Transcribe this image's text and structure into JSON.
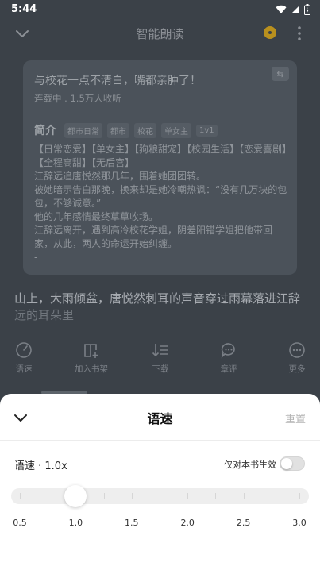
{
  "status_bar": {
    "time": "5:44"
  },
  "header": {
    "title": "智能朗读"
  },
  "book": {
    "title": "与校花一点不清白，嘴都亲肿了！",
    "status": "连载中 . 1.5万人收听",
    "intro_label": "简介",
    "tags": [
      "都市日常",
      "都市",
      "校花",
      "单女主",
      "1v1"
    ],
    "description": [
      "【日常恋爱】【单女主】【狗粮甜宠】【校园生活】【恋爱喜剧】【全程高甜】【无后宫】",
      "江辞远追唐悦然那几年，围着她团团转。",
      "被她暗示告白那晚，换来却是她冷嘲热讽：“没有几万块的包包，不够诚意。”",
      "他的几年感情最终草草收场。",
      "江辞远离开，遇到高冷校花学姐，阴差阳错学姐把他带回家，从此，两人的命运开始纠缠。",
      "-"
    ]
  },
  "reading": {
    "line1": "山上，大雨倾盆，唐悦然刺耳的声音穿过雨幕落进江辞",
    "line2": "远的耳朵里"
  },
  "toolbar": {
    "speed": "语速",
    "bookshelf": "加入书架",
    "chapters": "下载",
    "comments": "章评",
    "more": "更多"
  },
  "sheet": {
    "title": "语速",
    "reset": "重置",
    "speed_label": "语速 · 1.0x",
    "book_only_label": "仅对本书生效",
    "book_only_enabled": false,
    "current_speed": 1.0,
    "speed_ticks": [
      "0.5",
      "1.0",
      "1.5",
      "2.0",
      "2.5",
      "3.0"
    ]
  }
}
